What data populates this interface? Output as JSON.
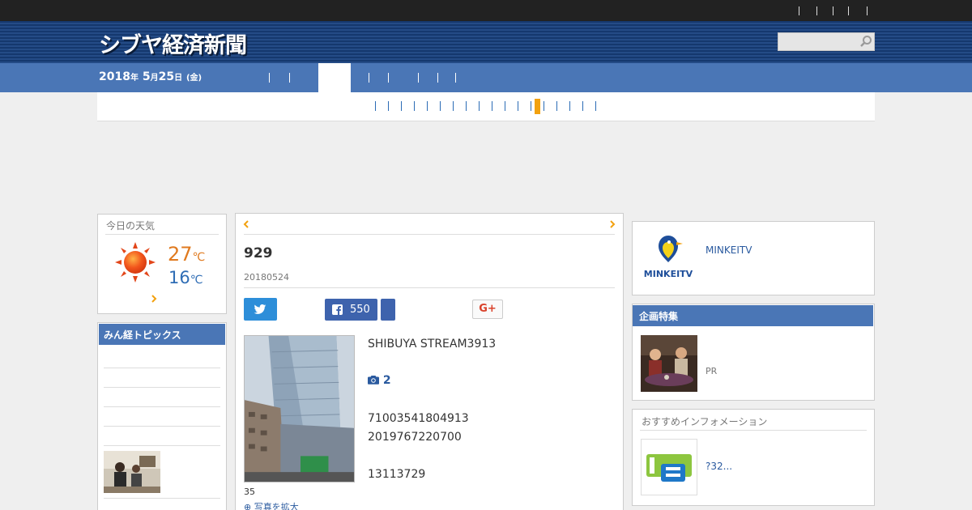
{
  "header": {
    "logo_text": "シブヤ経済新聞",
    "search_placeholder": ""
  },
  "navbar": {
    "date_year": "2018",
    "date_y_unit": "年",
    "date_month": "5",
    "date_m_unit": "月",
    "date_day": "25",
    "date_d_unit": "日",
    "date_weekday": "(金)"
  },
  "weather": {
    "title": "今日の天気",
    "high": "27",
    "low": "16",
    "unit": "℃",
    "icon": "sun-icon"
  },
  "topics": {
    "title": "みん経トピックス"
  },
  "article": {
    "title": "929",
    "date": "20180524",
    "fb_count": "550",
    "gplus_label": "G+",
    "photo_caption": "35",
    "enlarge_label": "写真を拡大",
    "text_1": "SHIBUYA STREAM3913",
    "photo_count": "2",
    "text_2": "71003541804913",
    "text_3": "2019767220700",
    "text_4": "13113729"
  },
  "right": {
    "minkei_label": "MINKEITV",
    "minkei_logo_text": "MINKEITV",
    "feature_title": "企画特集",
    "feature_pr": "PR",
    "info_title": "おすすめインフォメーション",
    "info_text": "?32..."
  },
  "colors": {
    "nav_blue": "#4a76b6",
    "accent_orange": "#f2a10f",
    "link_blue": "#2a5a9f"
  }
}
